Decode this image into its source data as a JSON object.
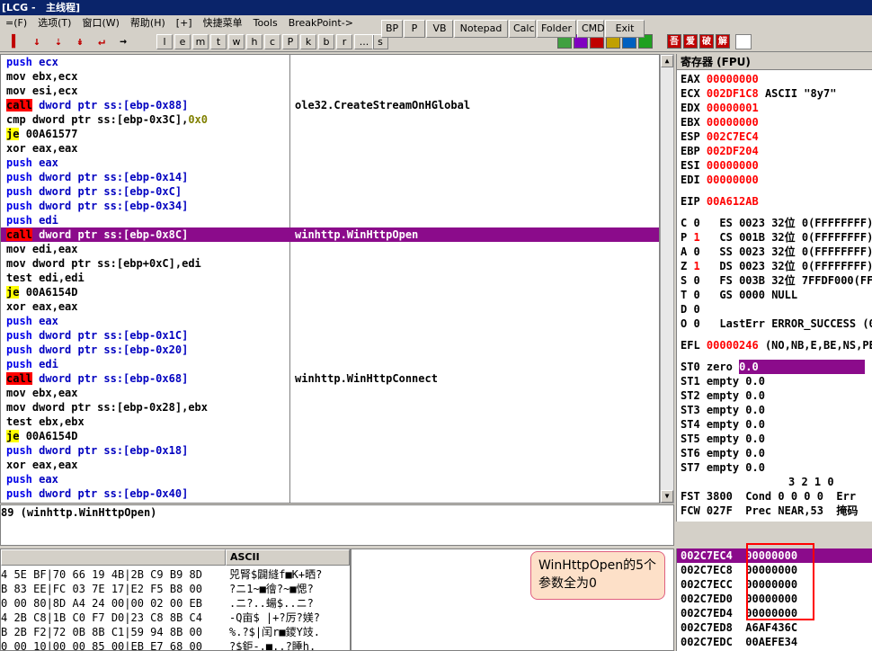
{
  "window": {
    "title": "[LCG -   主线程]"
  },
  "menu": [
    "=(F)",
    "选项(T)",
    "窗口(W)",
    "帮助(H)",
    "[+]",
    "快捷菜单",
    "Tools",
    "BreakPoint->"
  ],
  "ext_buttons": [
    "BP",
    "P",
    "VB",
    "Notepad",
    "Calc",
    "Folder",
    "CMD",
    "Exit"
  ],
  "toolbar_letters": [
    "l",
    "e",
    "m",
    "t",
    "w",
    "h",
    "c",
    "P",
    "k",
    "b",
    "r",
    "...",
    "s"
  ],
  "chinese_toolbar": [
    "吾",
    "爱",
    "破",
    "解"
  ],
  "disasm": [
    {
      "mn": "push",
      "op": "ecx",
      "cmt": ""
    },
    {
      "mn": "mov",
      "op": "ebx,ecx",
      "cmt": ""
    },
    {
      "mn": "mov",
      "op": "esi,ecx",
      "cmt": ""
    },
    {
      "mn": "call",
      "op": "dword ptr ss:[ebp-0x88]",
      "cmt": "ole32.CreateStreamOnHGlobal"
    },
    {
      "mn": "cmp",
      "op": "dword ptr ss:[ebp-0x3C],",
      "op2": "0x0",
      "cmt": ""
    },
    {
      "mn": "je",
      "op": "00A61577",
      "cmt": ""
    },
    {
      "mn": "xor",
      "op": "eax,eax",
      "cmt": ""
    },
    {
      "mn": "push",
      "op": "eax",
      "cmt": ""
    },
    {
      "mn": "push",
      "op": "dword ptr ss:[ebp-0x14]",
      "cmt": ""
    },
    {
      "mn": "push",
      "op": "dword ptr ss:[ebp-0xC]",
      "cmt": ""
    },
    {
      "mn": "push",
      "op": "dword ptr ss:[ebp-0x34]",
      "cmt": ""
    },
    {
      "mn": "push",
      "op": "edi",
      "cmt": ""
    },
    {
      "mn": "call",
      "op": "dword ptr ss:[ebp-0x8C]",
      "cmt": "winhttp.WinHttpOpen",
      "sel": true
    },
    {
      "mn": "mov",
      "op": "edi,eax",
      "cmt": ""
    },
    {
      "mn": "mov",
      "op": "dword ptr ss:[ebp+0xC],edi",
      "cmt": ""
    },
    {
      "mn": "test",
      "op": "edi,edi",
      "cmt": ""
    },
    {
      "mn": "je",
      "op": "00A6154D",
      "cmt": ""
    },
    {
      "mn": "xor",
      "op": "eax,eax",
      "cmt": ""
    },
    {
      "mn": "push",
      "op": "eax",
      "cmt": ""
    },
    {
      "mn": "push",
      "op": "dword ptr ss:[ebp-0x1C]",
      "cmt": ""
    },
    {
      "mn": "push",
      "op": "dword ptr ss:[ebp-0x20]",
      "cmt": ""
    },
    {
      "mn": "push",
      "op": "edi",
      "cmt": ""
    },
    {
      "mn": "call",
      "op": "dword ptr ss:[ebp-0x68]",
      "cmt": "winhttp.WinHttpConnect"
    },
    {
      "mn": "mov",
      "op": "ebx,eax",
      "cmt": ""
    },
    {
      "mn": "mov",
      "op": "dword ptr ss:[ebp-0x28],ebx",
      "cmt": ""
    },
    {
      "mn": "test",
      "op": "ebx,ebx",
      "cmt": ""
    },
    {
      "mn": "je",
      "op": "00A6154D",
      "cmt": ""
    },
    {
      "mn": "push",
      "op": "dword ptr ss:[ebp-0x18]",
      "cmt": ""
    },
    {
      "mn": "xor",
      "op": "eax,eax",
      "cmt": ""
    },
    {
      "mn": "push",
      "op": "eax",
      "cmt": ""
    },
    {
      "mn": "push",
      "op": "dword ptr ss:[ebp-0x40]",
      "cmt": ""
    }
  ],
  "info_line": "89 (winhttp.WinHttpOpen)",
  "registers": {
    "header": "寄存器 (FPU)",
    "gp": [
      {
        "name": "EAX",
        "value": "00000000",
        "extra": ""
      },
      {
        "name": "ECX",
        "value": "002DF1C8",
        "extra": "ASCII \"8y7\""
      },
      {
        "name": "EDX",
        "value": "00000001",
        "extra": ""
      },
      {
        "name": "EBX",
        "value": "00000000",
        "extra": ""
      },
      {
        "name": "ESP",
        "value": "002C7EC4",
        "extra": ""
      },
      {
        "name": "EBP",
        "value": "002DF204",
        "extra": ""
      },
      {
        "name": "ESI",
        "value": "00000000",
        "extra": ""
      },
      {
        "name": "EDI",
        "value": "00000000",
        "extra": ""
      }
    ],
    "eip": {
      "name": "EIP",
      "value": "00A612AB"
    },
    "flags": [
      {
        "f": "C",
        "v": "0",
        "red": false,
        "seg": "ES 0023 32位 0(FFFFFFFF)"
      },
      {
        "f": "P",
        "v": "1",
        "red": true,
        "seg": "CS 001B 32位 0(FFFFFFFF)"
      },
      {
        "f": "A",
        "v": "0",
        "red": false,
        "seg": "SS 0023 32位 0(FFFFFFFF)"
      },
      {
        "f": "Z",
        "v": "1",
        "red": true,
        "seg": "DS 0023 32位 0(FFFFFFFF)"
      },
      {
        "f": "S",
        "v": "0",
        "red": false,
        "seg": "FS 003B 32位 7FFDF000(FFF)"
      },
      {
        "f": "T",
        "v": "0",
        "red": false,
        "seg": "GS 0000 NULL"
      },
      {
        "f": "D",
        "v": "0",
        "red": false,
        "seg": ""
      },
      {
        "f": "O",
        "v": "0",
        "red": false,
        "seg": "LastErr ERROR_SUCCESS (0"
      }
    ],
    "efl": {
      "name": "EFL",
      "value": "00000246",
      "extra": "(NO,NB,E,BE,NS,PE"
    },
    "fpu": [
      {
        "name": "ST0",
        "state": "zero",
        "val": "0.0",
        "sel": true
      },
      {
        "name": "ST1",
        "state": "empty",
        "val": "0.0"
      },
      {
        "name": "ST2",
        "state": "empty",
        "val": "0.0"
      },
      {
        "name": "ST3",
        "state": "empty",
        "val": "0.0"
      },
      {
        "name": "ST4",
        "state": "empty",
        "val": "0.0"
      },
      {
        "name": "ST5",
        "state": "empty",
        "val": "0.0"
      },
      {
        "name": "ST6",
        "state": "empty",
        "val": "0.0"
      },
      {
        "name": "ST7",
        "state": "empty",
        "val": "0.0"
      }
    ],
    "fpu_bits_header": "3 2 1 0",
    "fst": "FST 3800  Cond 0 0 0 0  Err",
    "fcw": "FCW 027F  Prec NEAR,53  掩码"
  },
  "dump": {
    "ascii_header": "ASCII",
    "lines": [
      {
        "hex": "4 5E BF|70 66 19 4B|2B C9 B9 8D",
        "ascii": "兕腎$闢縫f■K+晒?"
      },
      {
        "hex": "B 83 EE|FC 03 7E 17|E2 F5 B8 00",
        "ascii": "?ニ1~■徻?~■愢?"
      },
      {
        "hex": "0 00 80|8D A4 24 00|00 02 00 EB",
        "ascii": ".ニ?..蝪$..ニ?"
      },
      {
        "hex": "4 2B C8|1B C0 F7 D0|23 C8 8B C4",
        "ascii": "-Q亩$ |+?厉?媄?"
      },
      {
        "hex": "B 2B F2|72 0B 8B C1|59 94 8B 00",
        "ascii": "%.?$|闰r■鑁Y攱."
      },
      {
        "hex": "0 00 10|00 00 85 00|EB E7 68 00",
        "ascii": "?$鉅-.■..?睡h."
      }
    ]
  },
  "stack": [
    {
      "addr": "002C7EC4",
      "val": "00000000",
      "sel": true
    },
    {
      "addr": "002C7EC8",
      "val": "00000000"
    },
    {
      "addr": "002C7ECC",
      "val": "00000000"
    },
    {
      "addr": "002C7ED0",
      "val": "00000000"
    },
    {
      "addr": "002C7ED4",
      "val": "00000000"
    },
    {
      "addr": "002C7ED8",
      "val": "A6AF436C"
    },
    {
      "addr": "002C7EDC",
      "val": "00AEFE34"
    }
  ],
  "callout": {
    "text": "WinHttpOpen的5个参数全为0"
  }
}
